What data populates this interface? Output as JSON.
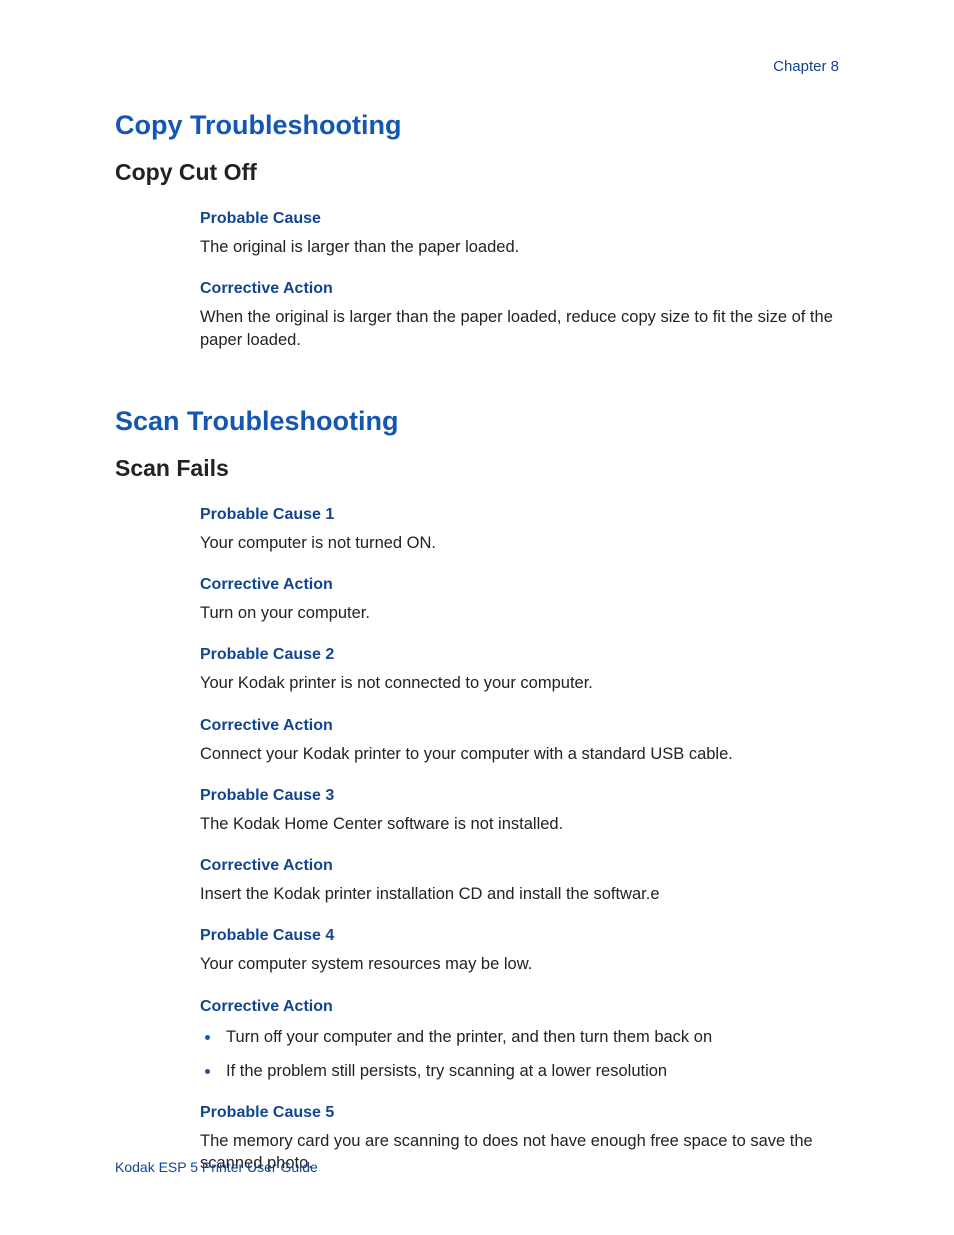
{
  "header": {
    "chapter_label": "Chapter 8"
  },
  "sections": {
    "copy": {
      "title": "Copy Troubleshooting",
      "subsection": {
        "title": "Copy Cut Off",
        "items": [
          {
            "heading": "Probable Cause",
            "text": "The original is larger than the paper loaded."
          },
          {
            "heading": "Corrective Action",
            "text": "When the original is larger than the paper loaded, reduce copy size to fit the size of the paper loaded."
          }
        ]
      }
    },
    "scan": {
      "title": "Scan Troubleshooting",
      "subsection": {
        "title": "Scan Fails",
        "items": [
          {
            "heading": "Probable Cause 1",
            "text": "Your computer is not turned ON."
          },
          {
            "heading": "Corrective Action",
            "text": "Turn on your computer."
          },
          {
            "heading": "Probable Cause 2",
            "text": "Your Kodak printer is not connected to your computer."
          },
          {
            "heading": "Corrective Action",
            "text": "Connect your Kodak printer to your computer with a standard USB cable."
          },
          {
            "heading": "Probable Cause 3",
            "text": "The Kodak Home Center software is not installed."
          },
          {
            "heading": "Corrective Action",
            "text": "Insert the Kodak printer installation CD and install the softwar.e"
          },
          {
            "heading": "Probable Cause 4",
            "text": "Your computer system resources may be low."
          },
          {
            "heading": "Corrective Action",
            "list": [
              "Turn off your computer and the printer, and then turn them back on",
              "If the problem still persists, try scanning at a lower resolution"
            ]
          },
          {
            "heading": "Probable Cause 5",
            "text": "The memory card you are scanning to does not have enough free space to save the scanned photo."
          }
        ]
      }
    }
  },
  "footer": {
    "text": "Kodak ESP 5 Printer User Guide"
  }
}
